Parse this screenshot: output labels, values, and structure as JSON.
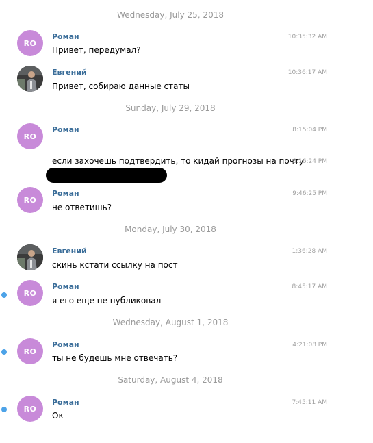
{
  "colors": {
    "avatar_bg": "#c88ad9",
    "sender": "#3a6d99",
    "date_separator": "#999999",
    "timestamp": "#a0a0a0",
    "unread_dot": "#4da3e8"
  },
  "chat": {
    "dates": [
      "Wednesday, July 25, 2018",
      "Sunday, July 29, 2018",
      "Monday, July 30, 2018",
      "Wednesday, August 1, 2018",
      "Saturday, August 4, 2018"
    ],
    "messages": [
      {
        "avatar": "RO",
        "sender": "Роман",
        "text": "Привет, передумал?",
        "time": "10:35:32 AM"
      },
      {
        "avatar_icon": "user-photo-icon",
        "sender": "Евгений",
        "text": "Привет, собираю данные статы",
        "time": "10:36:17 AM"
      },
      {
        "avatar": "RO",
        "sender": "Роман",
        "text": "",
        "time": "8:15:04 PM"
      },
      {
        "text": "если захочешь подтвердить, то кидай прогнозы на почту",
        "time": "8:16:24 PM"
      },
      {
        "avatar": "RO",
        "sender": "Роман",
        "text": "не ответишь?",
        "time": "9:46:25 PM"
      },
      {
        "avatar_icon": "user-photo-icon",
        "sender": "Евгений",
        "text": "скинь кстати ссылку на пост",
        "time": "1:36:28 AM"
      },
      {
        "avatar": "RO",
        "sender": "Роман",
        "text": "я его еще не публиковал",
        "time": "8:45:17 AM",
        "unread": true
      },
      {
        "avatar": "RO",
        "sender": "Роман",
        "text": "ты не будешь мне отвечать?",
        "time": "4:21:08 PM",
        "unread": true
      },
      {
        "avatar": "RO",
        "sender": "Роман",
        "text": "Ок",
        "time": "7:45:11 AM",
        "unread": true
      }
    ]
  }
}
